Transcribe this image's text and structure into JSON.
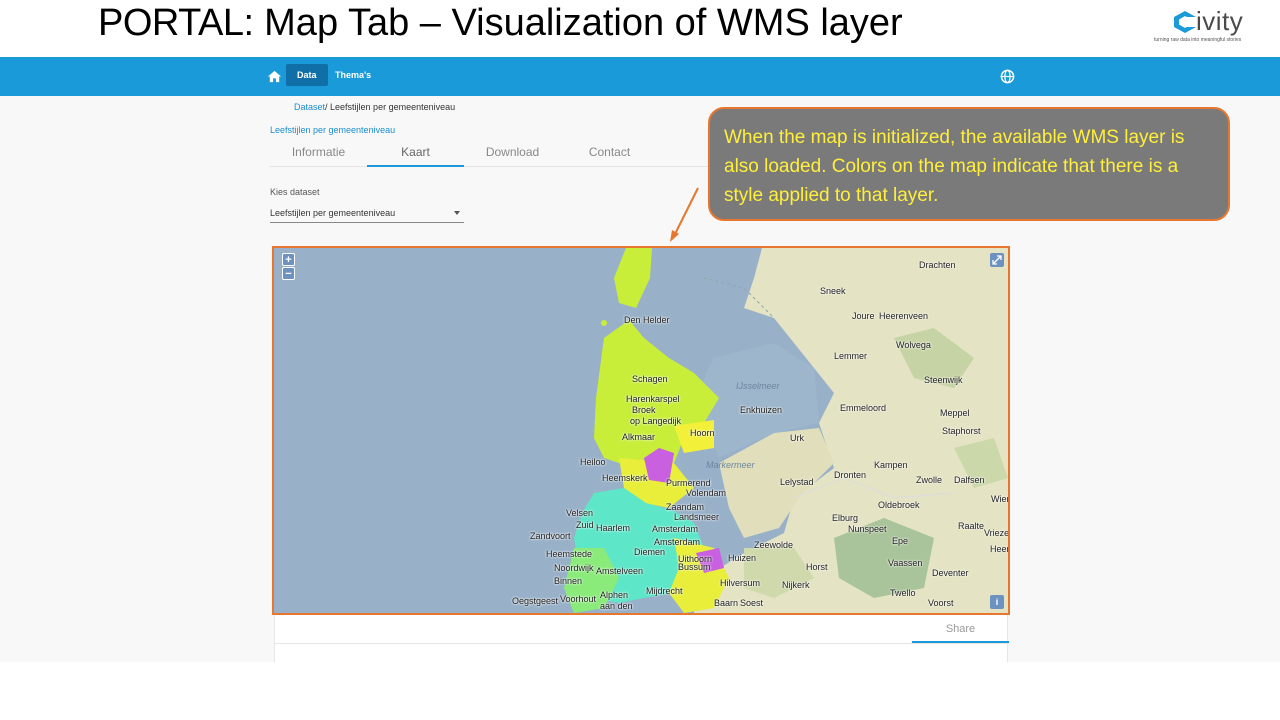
{
  "slide": {
    "title_bold": "PORTAL:",
    "title_rest": " Map Tab – Visualization of WMS layer"
  },
  "logo": {
    "word": "ivity",
    "tagline": "turning raw data into meaningful stories",
    "icon": "civity-logo"
  },
  "navbar": {
    "home_icon": "home-icon",
    "items": [
      {
        "label": "Data",
        "active": true
      },
      {
        "label": "Thema's",
        "active": false
      }
    ],
    "language_icon": "globe-icon",
    "color": "#1a9ad8"
  },
  "breadcrumb": {
    "link": "Dataset",
    "current": "/ Leefstijlen per gemeenteniveau"
  },
  "dataset_title": "Leefstijlen per gemeenteniveau",
  "tabs": [
    {
      "label": "Informatie",
      "active": false
    },
    {
      "label": "Kaart",
      "active": true
    },
    {
      "label": "Download",
      "active": false
    },
    {
      "label": "Contact",
      "active": false
    }
  ],
  "dataset_select": {
    "label": "Kies dataset",
    "value": "Leefstijlen per gemeenteniveau"
  },
  "map": {
    "zoom_in": "+",
    "zoom_out": "−",
    "info": "i",
    "labels": {
      "drachten": "Drachten",
      "sneek": "Sneek",
      "joure": "Joure",
      "heerenveen": "Heerenveen",
      "wolvega": "Wolvega",
      "lemmer": "Lemmer",
      "steenwijk": "Steenwijk",
      "den_helder": "Den Helder",
      "ijsselmeer": "IJsselmeer",
      "emmeloord": "Emmeloord",
      "meppel": "Meppel",
      "staphorst": "Staphorst",
      "schagen": "Schagen",
      "harenkarspel": "Harenkarspel",
      "broek": "Broek",
      "op_langedijk": "op Langedijk",
      "enkhuizen": "Enkhuizen",
      "urk": "Urk",
      "alkmaar": "Alkmaar",
      "hoorn": "Hoorn",
      "heiloo": "Heiloo",
      "kampen": "Kampen",
      "markermeer": "Markermeer",
      "heemskerk": "Heemskerk",
      "purmerend": "Purmerend",
      "lelystad": "Lelystad",
      "dronten": "Dronten",
      "zwolle": "Zwolle",
      "dalfsen": "Dalfsen",
      "volendam": "Volendam",
      "velsen": "Velsen",
      "zaandam": "Zaandam",
      "landsmeer": "Landsmeer",
      "oldebroek": "Oldebroek",
      "wierden": "Wier",
      "elburg": "Elburg",
      "nunspeet": "Nunspeet",
      "zandvoort": "Zandvoort",
      "zuid": "Zuid",
      "haarlem": "Haarlem",
      "amsterdam": "Amsterdam",
      "raalte": "Raalte",
      "vriezenveen": "Vriezen",
      "epe": "Epe",
      "heemstede": "Heemstede",
      "amsterdam2": "Amsterdam",
      "diemen": "Diemen",
      "zeewolde": "Zeewolde",
      "heerde": "Heer",
      "huizen": "Huizen",
      "noordwijk": "Noordwijk",
      "vaassen": "Vaassen",
      "uithoorn": "Uithoorn",
      "bussum": "Bussum",
      "horst": "Horst",
      "deventer": "Deventer",
      "amstelveen": "Amstelveen",
      "binnen": "Binnen",
      "hilversum": "Hilversum",
      "nijkerk": "Nijkerk",
      "mijdrecht": "Mijdrecht",
      "twello": "Twello",
      "oegstgeest": "Oegstgeest",
      "voorhout": "Voorhout",
      "alphen": "Alphen",
      "aan_den": "aan den",
      "baarn": "Baarn",
      "soest": "Soest",
      "voorst": "Voorst"
    }
  },
  "share": {
    "label": "Share"
  },
  "callout": {
    "text": "When the map is initialized, the available WMS layer is also loaded. Colors on the map indicate that there is a style applied to that layer."
  },
  "colors": {
    "accent": "#1a9ad8",
    "callout_border": "#e7772f",
    "callout_text": "#ffef3a",
    "callout_bg": "#7a7a7a"
  }
}
